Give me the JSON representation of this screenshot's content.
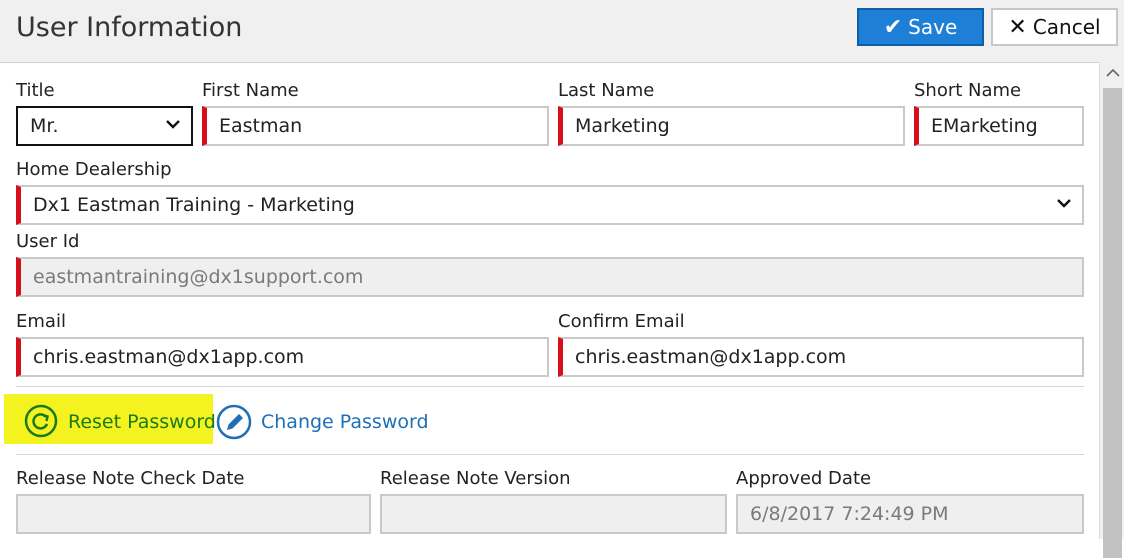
{
  "header": {
    "title": "User Information",
    "save_label": "Save",
    "cancel_label": "Cancel"
  },
  "fields": {
    "title": {
      "label": "Title",
      "value": "Mr."
    },
    "first_name": {
      "label": "First Name",
      "value": "Eastman"
    },
    "last_name": {
      "label": "Last Name",
      "value": "Marketing"
    },
    "short_name": {
      "label": "Short Name",
      "value": "EMarketing"
    },
    "home_dealership": {
      "label": "Home Dealership",
      "value": "Dx1 Eastman Training - Marketing"
    },
    "user_id": {
      "label": "User Id",
      "value": "eastmantraining@dx1support.com"
    },
    "email": {
      "label": "Email",
      "value": "chris.eastman@dx1app.com"
    },
    "confirm_email": {
      "label": "Confirm Email",
      "value": "chris.eastman@dx1app.com"
    },
    "release_note_check_date": {
      "label": "Release Note Check Date",
      "value": ""
    },
    "release_note_version": {
      "label": "Release Note Version",
      "value": ""
    },
    "approved_date": {
      "label": "Approved Date",
      "value": "6/8/2017 7:24:49 PM"
    }
  },
  "actions": {
    "reset_password": "Reset Password",
    "change_password": "Change Password"
  },
  "colors": {
    "accent": "#1e7fd6",
    "required": "#d6101a",
    "highlight": "#f4f31f",
    "reset_link": "#1a7a1a",
    "change_link": "#1f6fb5"
  },
  "icons": {
    "save": "check-icon",
    "cancel": "close-icon",
    "reset": "refresh-icon",
    "change": "pencil-icon"
  }
}
